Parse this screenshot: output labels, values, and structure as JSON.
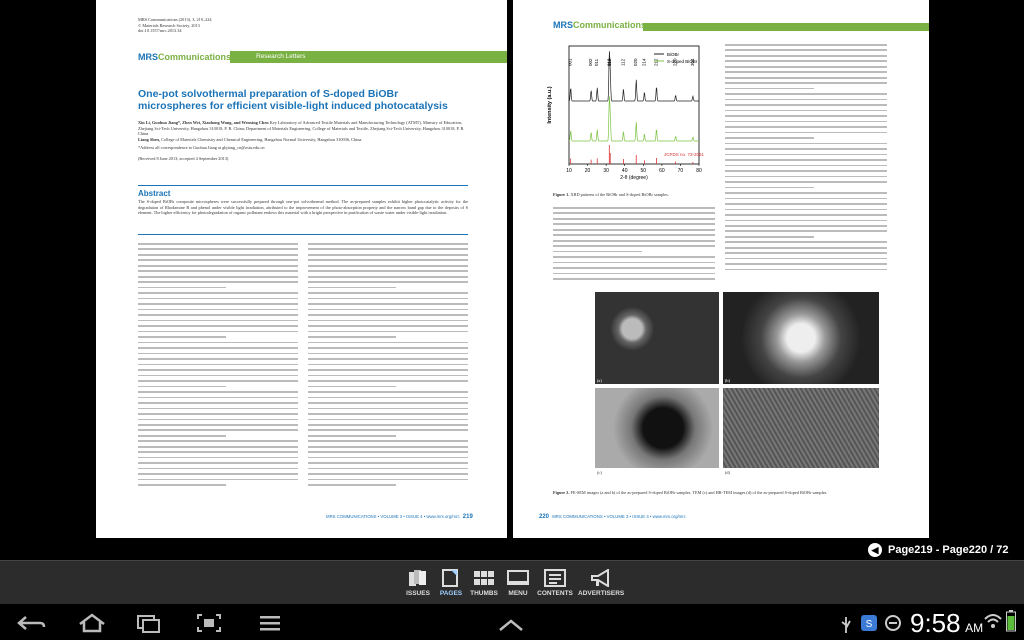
{
  "left_page": {
    "journal_header": "MRS Communications (2013), 3, 219–224",
    "journal_header2": "© Materials Research Society, 2013",
    "journal_header3": "doi:10.1557/mrc.2013.34",
    "section_label": "Research Letters",
    "title": "One-pot solvothermal preparation of S-doped BiOBr microspheres for efficient visible-light induced photocatalysis",
    "authors": "Xin Li, Guohua Jiang*, Zhen Wei, Xiaohong Wang, and Wenxing Chen",
    "affil": "Key Laboratory of Advanced Textile Materials and Manufacturing Technology (ATMT), Ministry of Education, Zhejiang Sci-Tech University, Hangzhou 310018, P. R. China; Department of Materials Engineering, College of Materials and Textile, Zhejiang Sci-Tech University, Hangzhou 310018, P. R. China",
    "author2": "Liang Shen,",
    "affil2": "College of Materials Chemistry and Chemical Engineering, Hangzhou Normal University, Hangzhou 310036, China",
    "correspondence": "*Address all correspondence to Guohua Jiang at ghjiang_cn@zstu.edu.cn",
    "received": "(Received 8 June 2013; accepted 4 September 2013)",
    "abstract_heading": "Abstract",
    "abstract": "The S-doped BiOBr composite microspheres were successfully prepared through one-pot solvothermal method. The as-prepared samples exhibit higher photocatalytic activity for the degradation of Rhodamine B and phenol under visible light irradiation, attributed to the improvement of the photo-absorption property and the narrow band gap due to the deposits of S element. The higher efficiency for photodegradation of organic pollutant endows this material with a bright perspective in purification of waste water under visible-light irradiation.",
    "footer": "MRS COMMUNICATIONS • VOLUME 3 • ISSUE 4 • www.mrs.org/mrc",
    "page_number": "219"
  },
  "right_page": {
    "page_number": "220",
    "footer": "MRS COMMUNICATIONS • VOLUME 3 • ISSUE 4 • www.mrs.org/mrc",
    "fig1_caption_label": "Figure 1.",
    "fig1_caption": "XRD patterns of the BiOBr and S-doped BiOBr samples.",
    "fig2_caption_label": "Figure 2.",
    "fig2_caption": "FE-SEM images (a and b) of the as-prepared S-doped BiOBr samples. TEM (c) and HR-TEM images (d) of the as-prepared S-doped BiOBr samples.",
    "panel_labels": [
      "(a)",
      "(b)",
      "(c)",
      "(d)"
    ]
  },
  "chart_data": {
    "type": "line",
    "xlabel": "2-θ (degree)",
    "ylabel": "Intensity (a.u.)",
    "xlim": [
      10,
      80
    ],
    "x_ticks": [
      "10",
      "20",
      "30",
      "40",
      "50",
      "60",
      "70",
      "80"
    ],
    "legend": [
      "BiOBr",
      "S-doped BiOBr"
    ],
    "series": [
      {
        "name": "BiOBr",
        "color": "#222222",
        "peaks": [
          [
            10.9,
            0.28
          ],
          [
            21.9,
            0.22
          ],
          [
            25.2,
            0.28
          ],
          [
            31.7,
            0.95
          ],
          [
            32.2,
            0.55
          ],
          [
            39.3,
            0.25
          ],
          [
            46.2,
            0.45
          ],
          [
            50.6,
            0.18
          ],
          [
            57.1,
            0.3
          ],
          [
            67.4,
            0.12
          ],
          [
            76.7,
            0.1
          ]
        ]
      },
      {
        "name": "S-doped BiOBr",
        "color": "#7cc242",
        "peaks": [
          [
            10.9,
            0.22
          ],
          [
            21.9,
            0.18
          ],
          [
            25.2,
            0.24
          ],
          [
            31.7,
            0.85
          ],
          [
            32.2,
            0.5
          ],
          [
            39.3,
            0.2
          ],
          [
            46.2,
            0.4
          ],
          [
            50.6,
            0.15
          ],
          [
            57.1,
            0.25
          ],
          [
            67.4,
            0.1
          ],
          [
            76.7,
            0.08
          ]
        ]
      }
    ],
    "peak_labels": [
      "001",
      "002",
      "011",
      "012",
      "110",
      "112",
      "020",
      "214",
      "212",
      "220",
      "304"
    ],
    "jcpds_label": "JCPDS no. 73-2061"
  },
  "page_indicator": "Page219 - Page220 / 72",
  "nav": {
    "items": [
      "ISSUES",
      "PAGES",
      "THUMBS",
      "MENU",
      "CONTENTS",
      "ADVERTISERS"
    ]
  },
  "status": {
    "time": "9:58",
    "ampm": "AM"
  }
}
